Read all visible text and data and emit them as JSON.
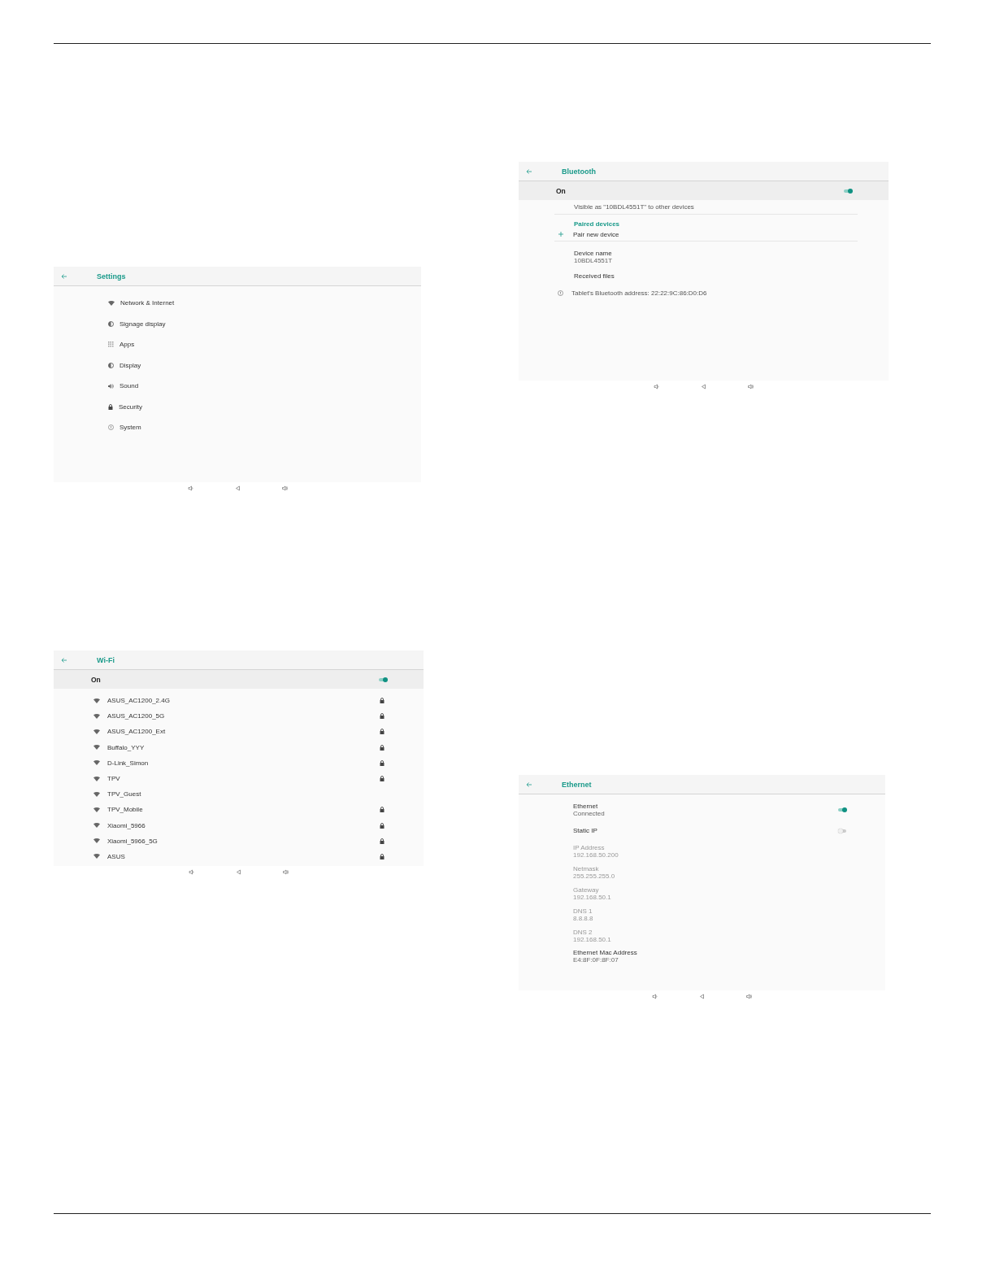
{
  "columns": [
    {
      "screens": [
        {
          "kind": "menu",
          "title": "Settings",
          "items": [
            {
              "label": "Network & Internet"
            },
            {
              "label": "Signage display"
            },
            {
              "label": "Apps"
            },
            {
              "label": "Display"
            },
            {
              "label": "Sound"
            },
            {
              "label": "Security"
            },
            {
              "label": "System"
            }
          ]
        },
        {
          "kind": "wifi",
          "title": "Wi-Fi",
          "master": {
            "label": "On",
            "on": true
          },
          "networks": [
            {
              "name": "ASUS_AC1200_2.4G",
              "locked": true
            },
            {
              "name": "ASUS_AC1200_5G",
              "locked": true
            },
            {
              "name": "ASUS_AC1200_Ext",
              "locked": true
            },
            {
              "name": "Buffalo_YYY",
              "locked": true
            },
            {
              "name": "D-Link_Simon",
              "locked": true
            },
            {
              "name": "TPV",
              "locked": true
            },
            {
              "name": "TPV_Guest",
              "locked": false
            },
            {
              "name": "TPV_Mobile",
              "locked": true
            },
            {
              "name": "Xiaomi_5966",
              "locked": true
            },
            {
              "name": "Xiaomi_5966_5G",
              "locked": true
            },
            {
              "name": "ASUS",
              "locked": true
            }
          ]
        }
      ]
    },
    {
      "screens": [
        {
          "kind": "bluetooth",
          "title": "Bluetooth",
          "master": {
            "label": "On",
            "on": true
          },
          "items": [
            {
              "kind": "note",
              "text": "Visible as \"10BDL4551T\" to other devices"
            },
            {
              "kind": "section",
              "text": "Paired devices"
            },
            {
              "kind": "action",
              "text": "Pair new device"
            },
            {
              "kind": "setting",
              "title": "Device name",
              "summary": "10BDL4551T"
            },
            {
              "kind": "setting",
              "title": "Received files"
            },
            {
              "kind": "info",
              "text": "Tablet's Bluetooth address: 22:22:9C:86:D0:D6"
            }
          ]
        },
        {
          "kind": "ethernet",
          "title": "Ethernet",
          "items": [
            {
              "kind": "switch",
              "title": "Ethernet",
              "summary": "Connected",
              "on": true
            },
            {
              "kind": "switch",
              "title": "Static IP",
              "on": false
            },
            {
              "kind": "field",
              "title": "IP Address",
              "summary": "192.168.50.200",
              "disabled": true
            },
            {
              "kind": "field",
              "title": "Netmask",
              "summary": "255.255.255.0",
              "disabled": true
            },
            {
              "kind": "field",
              "title": "Gateway",
              "summary": "192.168.50.1",
              "disabled": true
            },
            {
              "kind": "field",
              "title": "DNS 1",
              "summary": "8.8.8.8",
              "disabled": true
            },
            {
              "kind": "field",
              "title": "DNS 2",
              "summary": "192.168.50.1",
              "disabled": true
            },
            {
              "kind": "field",
              "title": "Ethernet Mac Address",
              "summary": "E4:8F:0F:8F:07",
              "disabled": false
            }
          ]
        }
      ]
    }
  ]
}
